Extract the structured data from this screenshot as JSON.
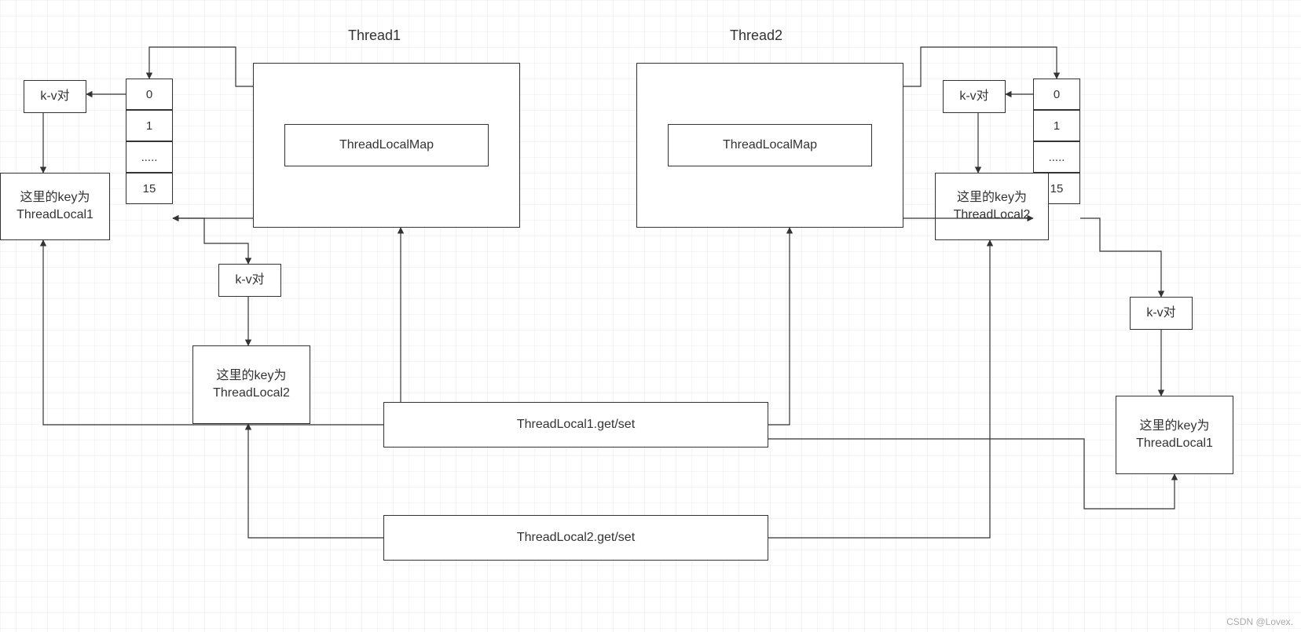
{
  "labels": {
    "thread1": "Thread1",
    "thread2": "Thread2",
    "map": "ThreadLocalMap",
    "kv": "k-v对",
    "key_tl1": "这里的key为\nThreadLocal1",
    "key_tl2": "这里的key为\nThreadLocal2",
    "get1": "ThreadLocal1.get/set",
    "get2": "ThreadLocal2.get/set",
    "watermark": "CSDN @Lovex."
  },
  "array_cells": [
    "0",
    "1",
    ".....",
    "15"
  ]
}
